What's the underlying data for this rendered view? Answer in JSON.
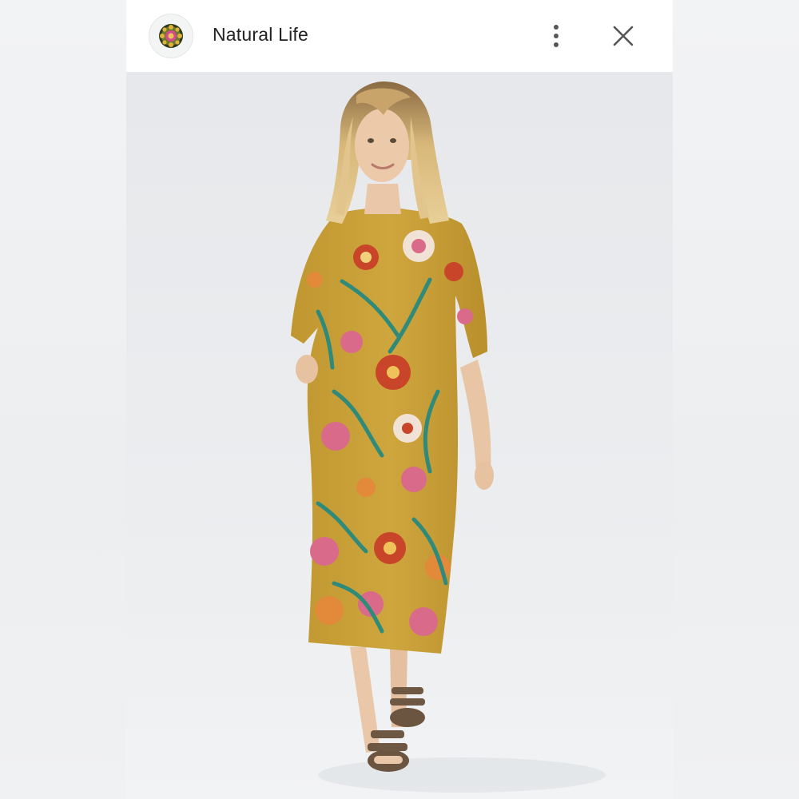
{
  "header": {
    "shop_name": "Natural Life",
    "avatar_icon": "natural-life-logo-icon",
    "menu_icon": "more-vertical-icon",
    "close_icon": "close-icon"
  },
  "photo": {
    "subject": "model-in-floral-dress-photo"
  },
  "colors": {
    "header_bg": "#ffffff",
    "photo_bg": "#e9ebee",
    "dress_base": "#c9a23a",
    "flower_red": "#c8452a",
    "flower_pink": "#d96a8a",
    "leaf_teal": "#2f8a7a",
    "sandal_brown": "#6b5540"
  }
}
